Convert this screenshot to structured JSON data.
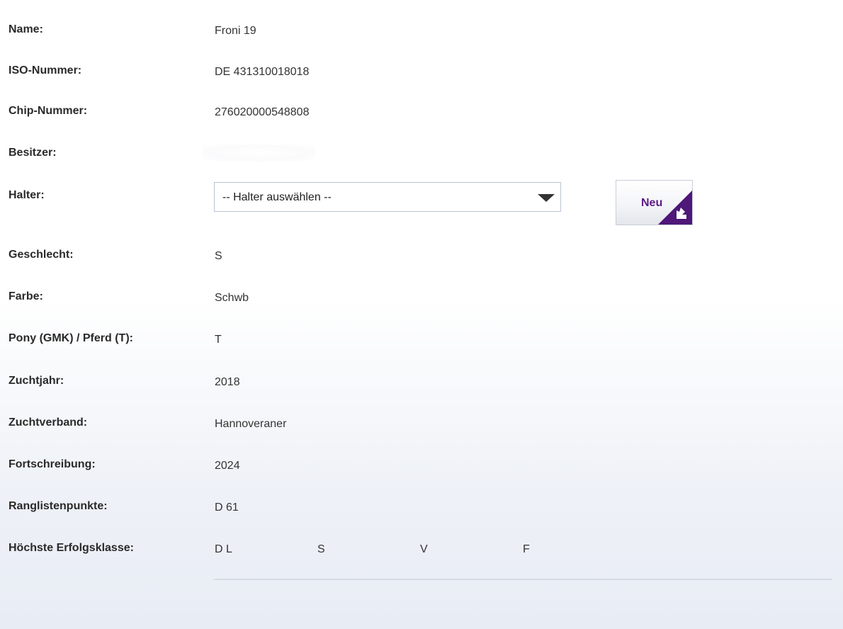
{
  "fields": {
    "name": {
      "label": "Name:",
      "value": "Froni 19"
    },
    "iso": {
      "label": "ISO-Nummer:",
      "value": "DE 431310018018"
    },
    "chip": {
      "label": "Chip-Nummer:",
      "value": "276020000548808"
    },
    "besitzer": {
      "label": "Besitzer:"
    },
    "halter": {
      "label": "Halter:",
      "select_value": "-- Halter auswählen --",
      "new_button": "Neu"
    },
    "geschlecht": {
      "label": "Geschlecht:",
      "value": "S"
    },
    "farbe": {
      "label": "Farbe:",
      "value": "Schwb"
    },
    "pony": {
      "label": "Pony (GMK) / Pferd (T):",
      "value": "T"
    },
    "zuchtjahr": {
      "label": "Zuchtjahr:",
      "value": "2018"
    },
    "zuchtverband": {
      "label": "Zuchtverband:",
      "value": "Hannoveraner"
    },
    "fortschreibung": {
      "label": "Fortschreibung:",
      "value": "2024"
    },
    "ranglistenpunkte": {
      "label": "Ranglistenpunkte:",
      "value": "D 61"
    },
    "erfolgsklasse": {
      "label": "Höchste Erfolgsklasse:",
      "values": [
        "D L",
        "S",
        "V",
        "F"
      ]
    }
  },
  "colors": {
    "accent": "#5b1a86",
    "label": "#2a2a2a",
    "text": "#333333",
    "divider": "#d7dce4"
  },
  "icons": {
    "dropdown": "caret-down-icon",
    "new_button_corner": "arrow-down-left-icon"
  }
}
